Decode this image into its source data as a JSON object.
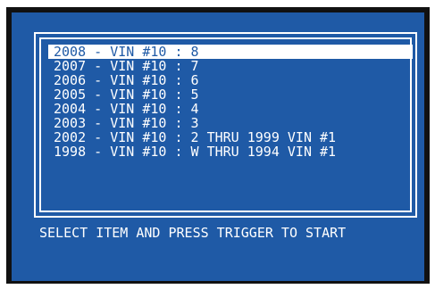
{
  "colors": {
    "screen_bg": "#1f5aa6",
    "text": "#ffffff",
    "selected_bg": "#ffffff",
    "selected_text": "#1f5aa6"
  },
  "menu": {
    "selected_index": 0,
    "items": [
      {
        "label": "2008 - VIN #10 : 8"
      },
      {
        "label": "2007 - VIN #10 : 7"
      },
      {
        "label": "2006 - VIN #10 : 6"
      },
      {
        "label": "2005 - VIN #10 : 5"
      },
      {
        "label": "2004 - VIN #10 : 4"
      },
      {
        "label": "2003 - VIN #10 : 3"
      },
      {
        "label": "2002 - VIN #10 : 2 THRU 1999 VIN #1"
      },
      {
        "label": "1998 - VIN #10 : W THRU 1994 VIN #1"
      }
    ]
  },
  "footer": {
    "instruction": "SELECT ITEM AND PRESS TRIGGER TO START"
  }
}
